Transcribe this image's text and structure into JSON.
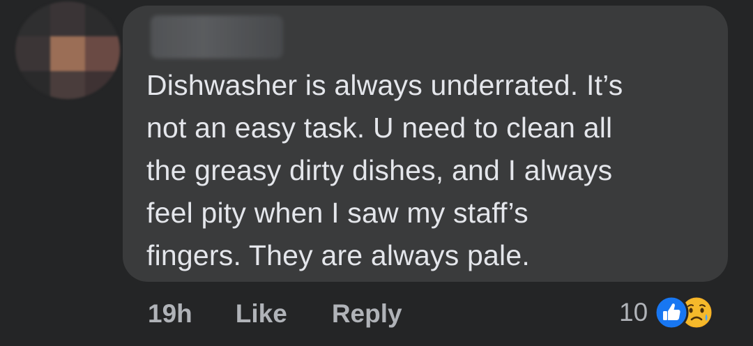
{
  "comment": {
    "text": "Dishwasher is always underrated. It’s\nnot an easy task. U need to clean all\nthe greasy dirty dishes, and I always\nfeel pity when I saw my staff’s\nfingers. They are always pale."
  },
  "actions": {
    "time": "19h",
    "like_label": "Like",
    "reply_label": "Reply"
  },
  "reactions": {
    "count": "10",
    "icons": [
      "like-icon",
      "sad-icon"
    ]
  },
  "colors": {
    "background": "#242526",
    "bubble": "#3a3b3c",
    "text": "#e4e6eb",
    "muted": "#b0b3b8",
    "like_blue": "#1877f2",
    "sad_yellow": "#f7b125"
  }
}
